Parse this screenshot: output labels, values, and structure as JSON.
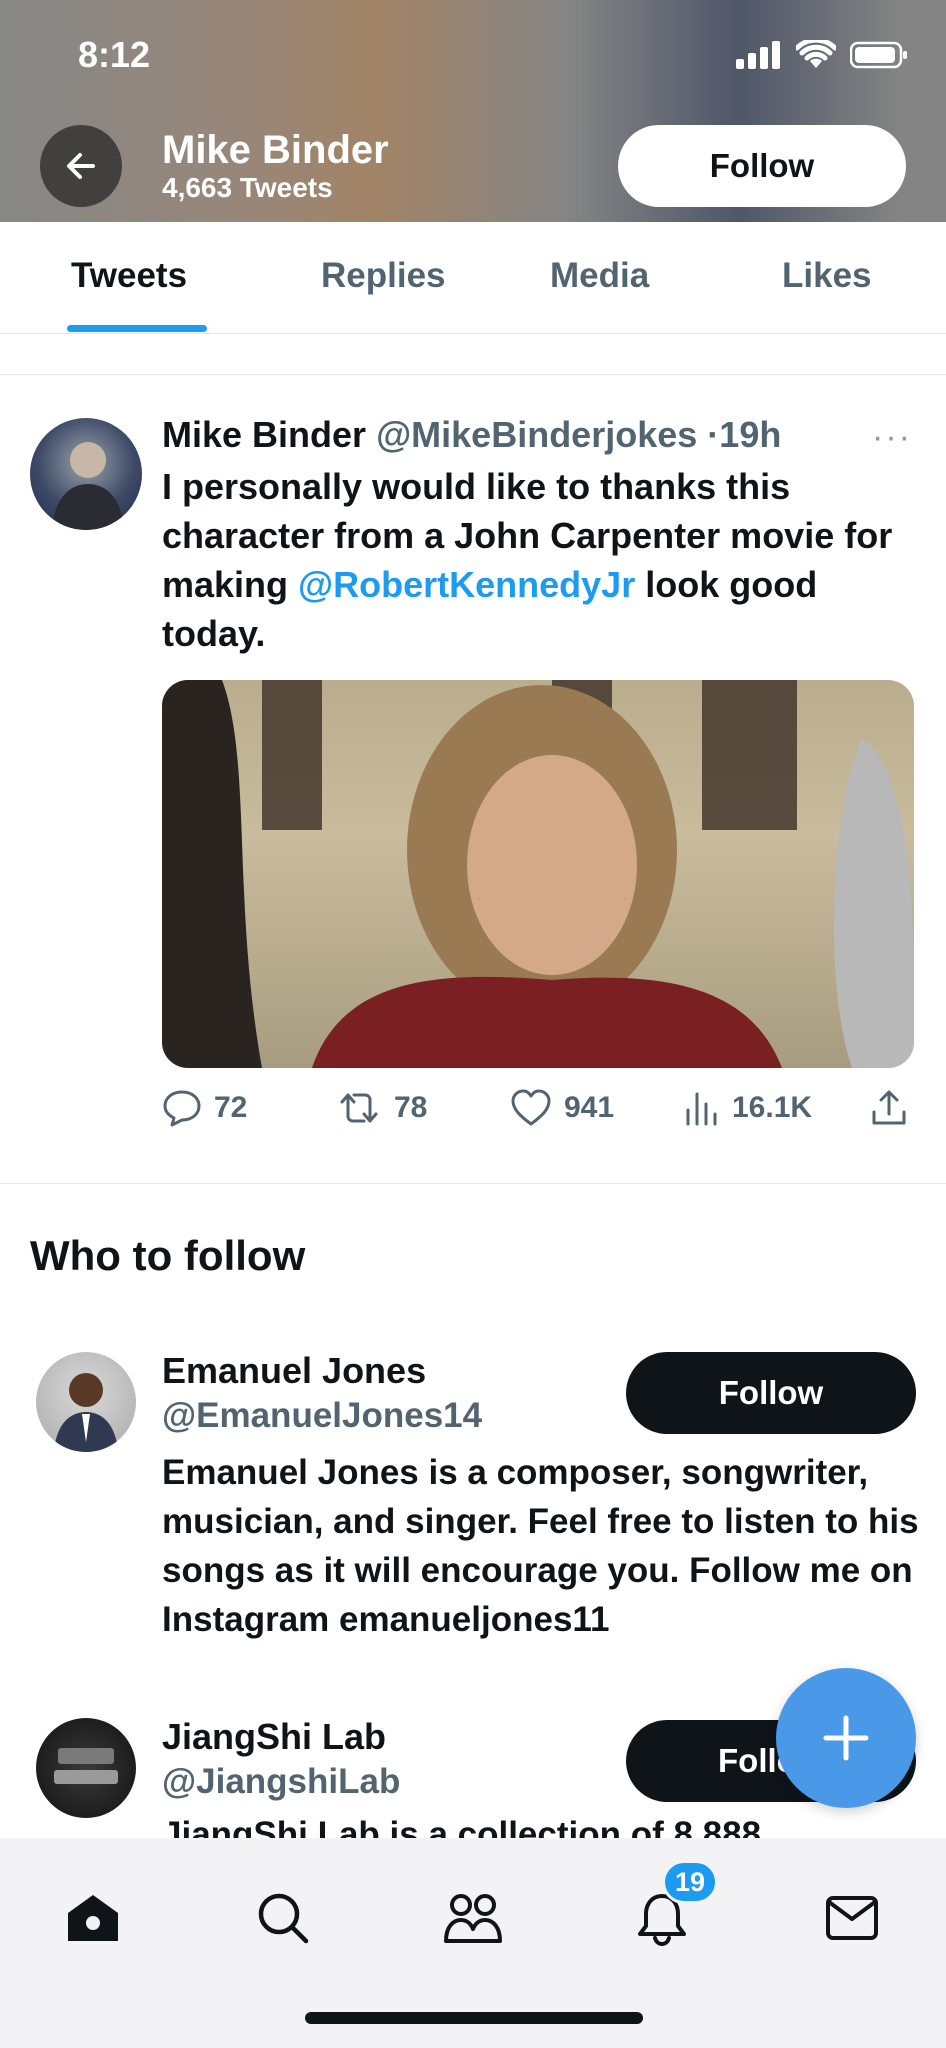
{
  "status_bar": {
    "time": "8:12"
  },
  "header": {
    "name": "Mike Binder",
    "tweet_count": "4,663 Tweets",
    "follow_label": "Follow"
  },
  "tabs": [
    {
      "label": "Tweets",
      "active": true
    },
    {
      "label": "Replies",
      "active": false
    },
    {
      "label": "Media",
      "active": false
    },
    {
      "label": "Likes",
      "active": false
    }
  ],
  "tweet": {
    "author_name": "Mike Binder",
    "author_handle": "@MikeBinderjokes",
    "separator": "·",
    "time": "19h",
    "more": "···",
    "text_before": "I personally would like to thanks this character from a John Carpenter movie for making ",
    "mention": "@RobertKennedyJr",
    "text_after": " look good today.",
    "replies": "72",
    "retweets": "78",
    "likes": "941",
    "views": "16.1K"
  },
  "who_to_follow": {
    "title": "Who to follow",
    "users": [
      {
        "name": "Emanuel Jones",
        "handle": "@EmanuelJones14",
        "bio": "Emanuel Jones is a composer, songwriter, musician, and singer. Feel free to listen to his songs as it will encourage you. Follow me on Instagram emanueljones11",
        "follow_label": "Follow"
      },
      {
        "name": "JiangShi Lab",
        "handle": "@JiangshiLab",
        "bio": "JiangShi Lab is a collection of 8,888",
        "follow_label": "Follow"
      }
    ]
  },
  "bottom_nav": {
    "notifications_badge": "19"
  },
  "colors": {
    "accent": "#1d9bf0",
    "fab": "#4a99e9",
    "text_primary": "#0f1419",
    "text_secondary": "#536471"
  }
}
